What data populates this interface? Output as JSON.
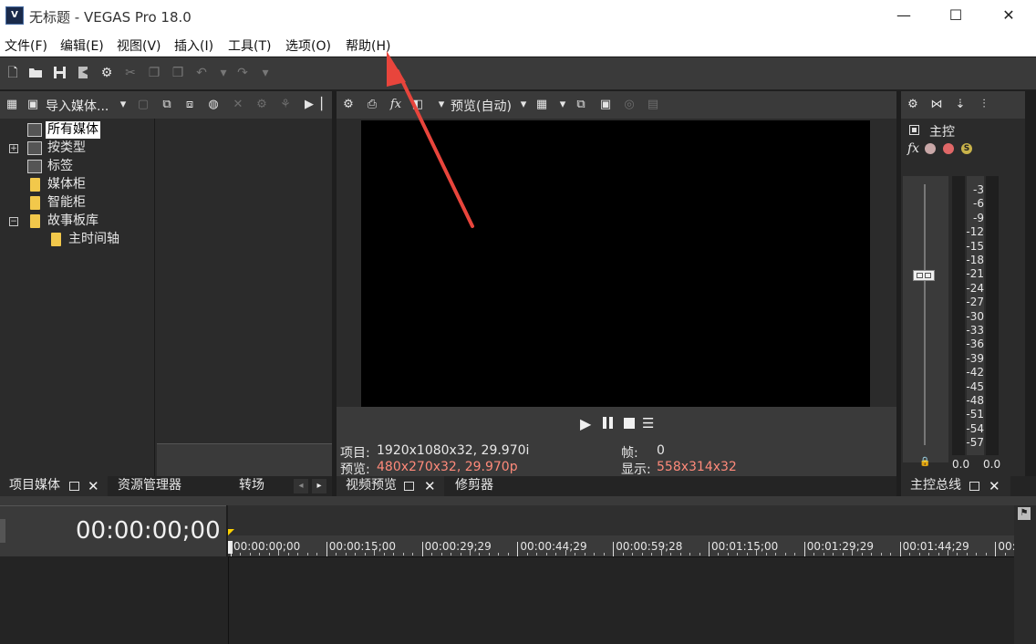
{
  "window": {
    "app_logo": "V",
    "title": "无标题 - VEGAS Pro 18.0",
    "minimize": "—",
    "maximize": "☐",
    "close": "✕"
  },
  "menu": [
    "文件(F)",
    "编辑(E)",
    "视图(V)",
    "插入(I)",
    "工具(T)",
    "选项(O)",
    "帮助(H)"
  ],
  "project_media": {
    "import_label": "导入媒体...",
    "tree": [
      {
        "label": "所有媒体",
        "icon": "media-bin-icon",
        "selected": true
      },
      {
        "label": "按类型",
        "icon": "media-bin-icon",
        "expander": "+"
      },
      {
        "label": "标签",
        "icon": "media-bin-icon"
      },
      {
        "label": "媒体柜",
        "icon": "folder-icon"
      },
      {
        "label": "智能柜",
        "icon": "folder-icon"
      },
      {
        "label": "故事板库",
        "icon": "folder-icon",
        "expander": "−"
      },
      {
        "label": "主时间轴",
        "icon": "folder-icon"
      }
    ],
    "tabs": [
      "项目媒体",
      "资源管理器",
      "转场"
    ]
  },
  "preview": {
    "mode_label": "预览(自动)",
    "project_label": "项目:",
    "project_value": "1920x1080x32, 29.970i",
    "preview_label": "预览:",
    "preview_value": "480x270x32, 29.970p",
    "frame_label": "帧:",
    "frame_value": "0",
    "display_label": "显示:",
    "display_value": "558x314x32",
    "tabs": [
      "视频预览",
      "修剪器"
    ]
  },
  "master": {
    "label": "主控",
    "ticks": [
      "3",
      "6",
      "9",
      "12",
      "15",
      "18",
      "21",
      "24",
      "27",
      "30",
      "33",
      "36",
      "39",
      "42",
      "45",
      "48",
      "51",
      "54",
      "57"
    ],
    "left_value": "0.0",
    "right_value": "0.0",
    "tab": "主控总线"
  },
  "timeline": {
    "timecode": "00:00:00;00",
    "ruler": [
      "00:00:00;00",
      "00:00:15;00",
      "00:00:29;29",
      "00:00:44;29",
      "00:00:59;28",
      "00:01:15;00",
      "00:01:29;29",
      "00:01:44;29",
      "00:0"
    ]
  },
  "colors": {
    "panel_bg": "#2b2b2b",
    "toolbar_bg": "#3a3a3a",
    "accent_red": "#ff8a7a",
    "annotation_arrow": "#e8453c"
  }
}
